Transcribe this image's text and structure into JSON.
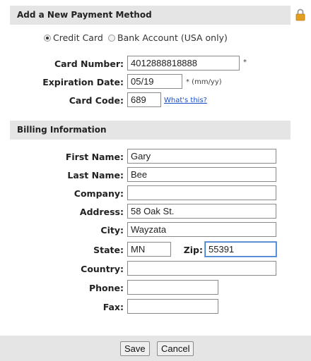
{
  "payment": {
    "header": "Add a New Payment Method",
    "options": [
      {
        "label": "Credit Card",
        "checked": true
      },
      {
        "label": "Bank Account  (USA only)",
        "checked": false
      }
    ],
    "card_number": {
      "label": "Card Number:",
      "value": "4012888818888",
      "required_mark": "*"
    },
    "expiration": {
      "label": "Expiration Date:",
      "value": "05/19",
      "hint": "* (mm/yy)"
    },
    "card_code": {
      "label": "Card Code:",
      "value": "689",
      "link": "What's this?"
    }
  },
  "billing": {
    "header": "Billing Information",
    "first_name": {
      "label": "First Name:",
      "value": "Gary"
    },
    "last_name": {
      "label": "Last Name:",
      "value": "Bee"
    },
    "company": {
      "label": "Company:",
      "value": ""
    },
    "address": {
      "label": "Address:",
      "value": "58 Oak St."
    },
    "city": {
      "label": "City:",
      "value": "Wayzata"
    },
    "state": {
      "label": "State:",
      "value": "MN"
    },
    "zip": {
      "label": "Zip:",
      "value": "55391"
    },
    "country": {
      "label": "Country:",
      "value": ""
    },
    "phone": {
      "label": "Phone:",
      "value": ""
    },
    "fax": {
      "label": "Fax:",
      "value": ""
    }
  },
  "actions": {
    "save": "Save",
    "cancel": "Cancel"
  },
  "colors": {
    "header_bg": "#e5e5e5",
    "link": "#1a4fc8",
    "focus_border": "#3c78c8",
    "lock": "#e3a020"
  }
}
